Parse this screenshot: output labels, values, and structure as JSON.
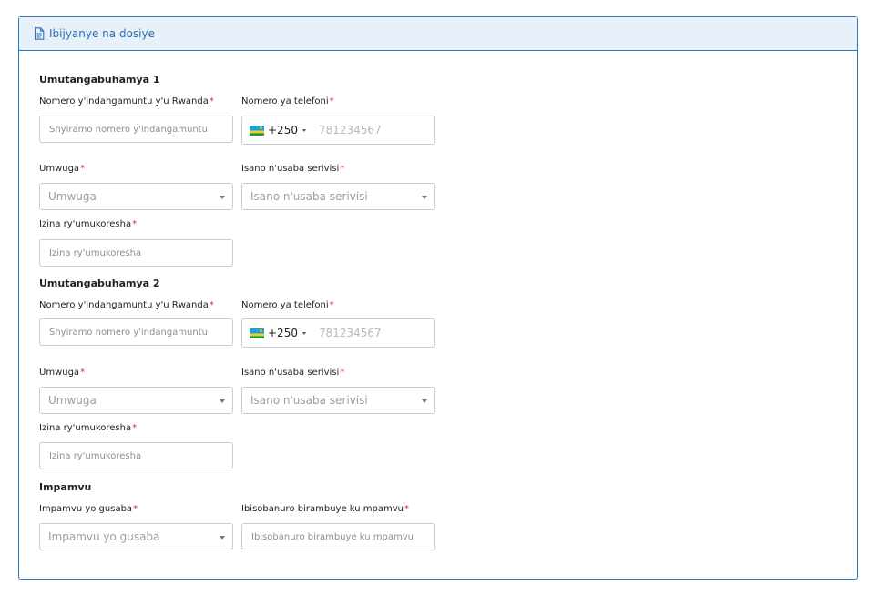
{
  "header": {
    "title": "Ibijyanye na dosiye"
  },
  "referees": [
    {
      "title": "Umutangabuhamya 1",
      "id_label": "Nomero y'indangamuntu y'u Rwanda",
      "id_placeholder": "Shyiramo nomero y'indangamuntu",
      "phone_label": "Nomero ya telefoni",
      "phone_code": "+250",
      "phone_placeholder": "781234567",
      "occupation_label": "Umwuga",
      "occupation_placeholder": "Umwuga",
      "service_label": "Isano n'usaba serivisi",
      "service_placeholder": "Isano n'usaba serivisi",
      "employer_label": "Izina ry'umukoresha",
      "employer_placeholder": "Izina ry'umukoresha"
    },
    {
      "title": "Umutangabuhamya 2",
      "id_label": "Nomero y'indangamuntu y'u Rwanda",
      "id_placeholder": "Shyiramo nomero y'indangamuntu",
      "phone_label": "Nomero ya telefoni",
      "phone_code": "+250",
      "phone_placeholder": "781234567",
      "occupation_label": "Umwuga",
      "occupation_placeholder": "Umwuga",
      "service_label": "Isano n'usaba serivisi",
      "service_placeholder": "Isano n'usaba serivisi",
      "employer_label": "Izina ry'umukoresha",
      "employer_placeholder": "Izina ry'umukoresha"
    }
  ],
  "reason": {
    "title": "Impamvu",
    "reason_label": "Impamvu yo gusaba",
    "reason_placeholder": "Impamvu yo gusaba",
    "details_label": "Ibisobanuro birambuye ku mpamvu",
    "details_placeholder": "Ibisobanuro birambuye ku mpamvu"
  },
  "required_mark": "*",
  "colors": {
    "accent": "#2f78c0",
    "header_bg": "#e8f1fa",
    "required": "#e0293d"
  },
  "icons": {
    "header": "document-icon",
    "flag": "rwanda-flag-icon",
    "select": "chevron-down-icon"
  }
}
